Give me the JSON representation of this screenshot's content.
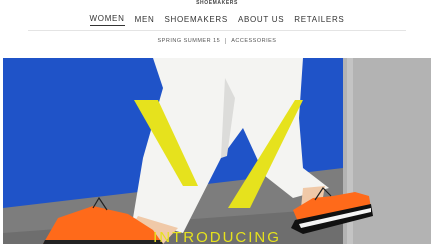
{
  "brand": {
    "name": "SHOEMAKERS"
  },
  "main_nav": {
    "items": [
      {
        "label": "WOMEN"
      },
      {
        "label": "MEN"
      },
      {
        "label": "SHOEMAKERS"
      },
      {
        "label": "ABOUT US"
      },
      {
        "label": "RETAILERS"
      }
    ],
    "active_index": 0
  },
  "sub_nav": {
    "items": [
      {
        "label": "SPRING SUMMER 15"
      },
      {
        "label": "ACCESSORIES"
      }
    ]
  },
  "hero": {
    "caption": "INTRODUCING",
    "logo_icon": "yellow-v-logo-icon"
  },
  "colors": {
    "accent_yellow": "#e6e21d",
    "wall_blue": "#1f53c8",
    "shoe_orange": "#ff6a1a",
    "nav_text": "#333333"
  }
}
